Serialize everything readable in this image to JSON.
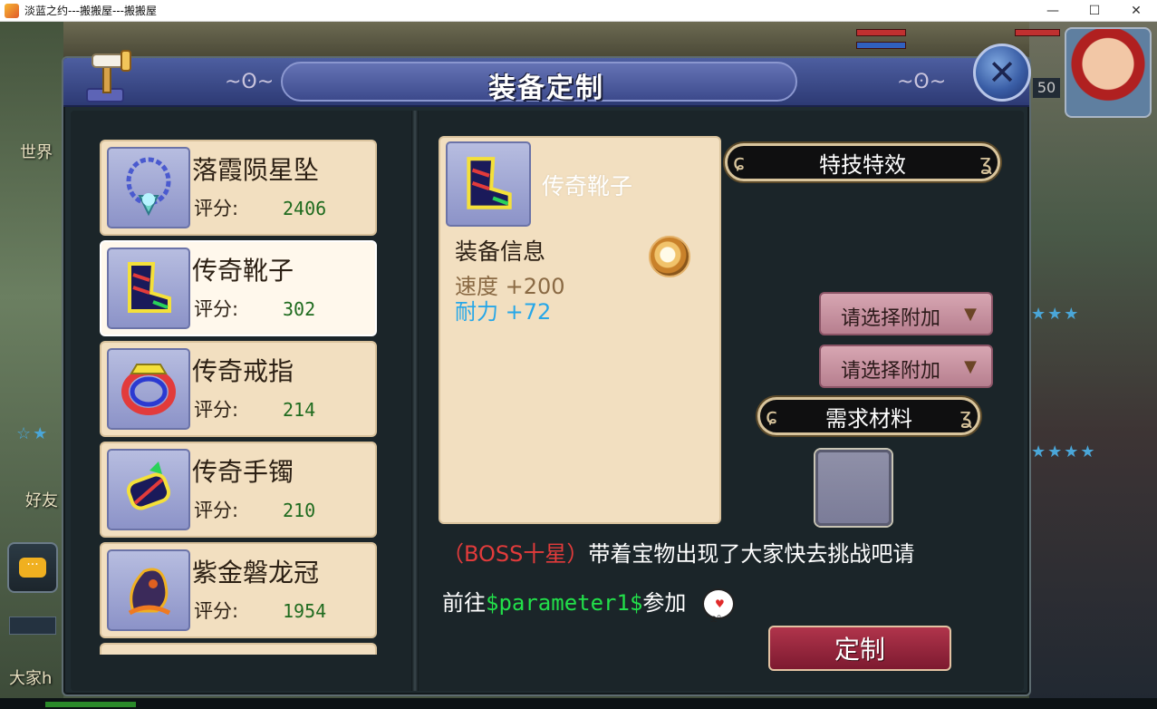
{
  "window": {
    "title": "淡蓝之约---搬搬屋---搬搬屋",
    "minimize_glyph": "—",
    "maximize_glyph": "☐",
    "close_glyph": "✕"
  },
  "background": {
    "world_label": "世界",
    "friend_label": "好友",
    "everyone_label": "大家h",
    "level": "50",
    "chat_glyph": "···"
  },
  "dialog": {
    "title": "装备定制",
    "close_glyph": "✕"
  },
  "equipment_list": [
    {
      "name": "落霞陨星坠",
      "score_label": "评分:",
      "score": "2406",
      "icon": "pendant-icon"
    },
    {
      "name": "传奇靴子",
      "score_label": "评分:",
      "score": "302",
      "icon": "boots-icon",
      "selected": true
    },
    {
      "name": "传奇戒指",
      "score_label": "评分:",
      "score": "214",
      "icon": "ring-icon"
    },
    {
      "name": "传奇手镯",
      "score_label": "评分:",
      "score": "210",
      "icon": "bracelet-icon"
    },
    {
      "name": "紫金磐龙冠",
      "score_label": "评分:",
      "score": "1954",
      "icon": "crown-icon"
    }
  ],
  "detail": {
    "name": "传奇靴子",
    "info_heading": "装备信息",
    "stats": [
      {
        "label": "速度",
        "value": "+200",
        "color": "#8a6a44"
      },
      {
        "label": "耐力",
        "value": "+72",
        "color": "#27a7e8"
      }
    ]
  },
  "right": {
    "skill_banner": "特技特效",
    "select_1": "请选择附加",
    "select_2": "请选择附加",
    "materials_banner": "需求材料",
    "arrow_glyph": "▼"
  },
  "notice": {
    "red_part": "（BOSS十星）",
    "white_part": "带着宝物出现了大家快去挑战吧请",
    "line2_prefix": "前往",
    "param": "$parameter1$",
    "line2_suffix": "参加",
    "heart": "♥"
  },
  "custom_button": "定制",
  "colors": {
    "card_bg": "#f2dfc0",
    "score_green": "#1f6b1f",
    "notice_red": "#e23b3b",
    "notice_green": "#22e04a",
    "button_red": "#9e2840"
  }
}
